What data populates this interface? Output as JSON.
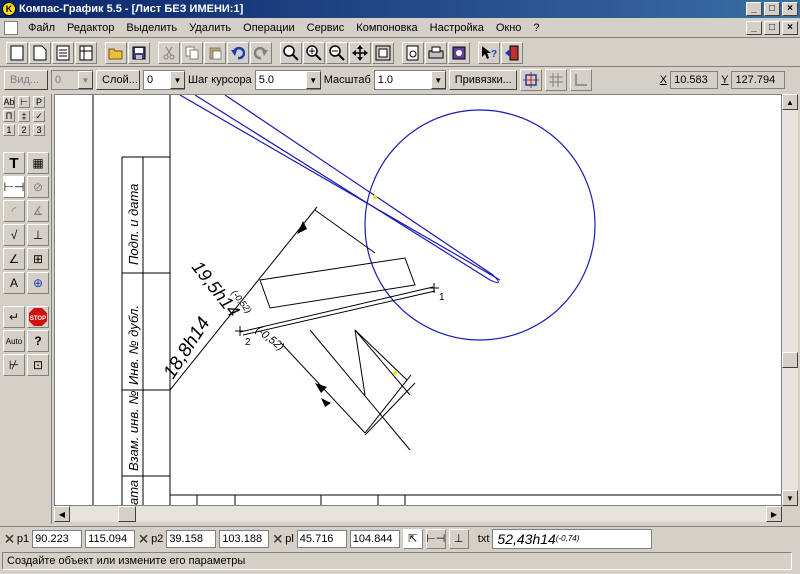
{
  "window": {
    "title": "Компас-График 5.5 - [Лист БЕЗ ИМЕНИ:1]"
  },
  "menu": {
    "items": [
      "Файл",
      "Редактор",
      "Выделить",
      "Удалить",
      "Операции",
      "Сервис",
      "Компоновка",
      "Настройка",
      "Окно",
      "?"
    ]
  },
  "toolbar": {
    "icons": [
      "new-sheet-icon",
      "new-fragment-icon",
      "new-text-doc-icon",
      "new-spec-icon",
      "open-icon",
      "save-icon",
      "cut-icon",
      "copy-icon",
      "paste-icon",
      "undo-icon",
      "redo-icon",
      "zoom-frame-icon",
      "zoom-in-icon",
      "zoom-out-icon",
      "pan-icon",
      "zoom-all-icon",
      "print-preview-icon",
      "print-icon",
      "3d-icon",
      "help-icon",
      "exit-icon"
    ]
  },
  "params": {
    "view_button": "Вид...",
    "view_value": "0",
    "layer_button": "Слой...",
    "layer_value": "0",
    "step_label": "Шаг курсора",
    "step_value": "5.0",
    "scale_label": "Масштаб",
    "scale_value": "1.0",
    "snaps_button": "Привязки...",
    "x_label": "X",
    "x_value": "10.583",
    "y_label": "Y",
    "y_value": "127.794"
  },
  "left_tools": {
    "small": [
      "Ab",
      "P",
      "П",
      "1",
      "2",
      "3"
    ],
    "stop_label": "STOP",
    "auto_label": "Auto",
    "help_label": "?"
  },
  "drawing": {
    "dim1": "19,5h14",
    "dim1_tol": "(-0,52)",
    "dim2": "18,8h14",
    "dim2_tol": "(-0,52)",
    "point1": "1",
    "point2": "2",
    "stamp_1": "Подп. и дата",
    "stamp_2": "Инв. № дубл.",
    "stamp_3": "Взам. инв. №",
    "stamp_4": "ата"
  },
  "props": {
    "p1_label": "p1",
    "p1_x": "90.223",
    "p1_y": "115.094",
    "p2_label": "p2",
    "p2_x": "39.158",
    "p2_y": "103.188",
    "pl_label": "pl",
    "pl_x": "45.716",
    "pl_y": "104.844",
    "txt_label": "txt",
    "text_value": "52,43h14",
    "text_tol": "(-0,74)"
  },
  "status": {
    "message": "Создайте объект или измените его параметры"
  },
  "colors": {
    "title_bar": "#0a246a",
    "circle": "#1a1ab4",
    "window_bg": "#d4d0c8"
  }
}
